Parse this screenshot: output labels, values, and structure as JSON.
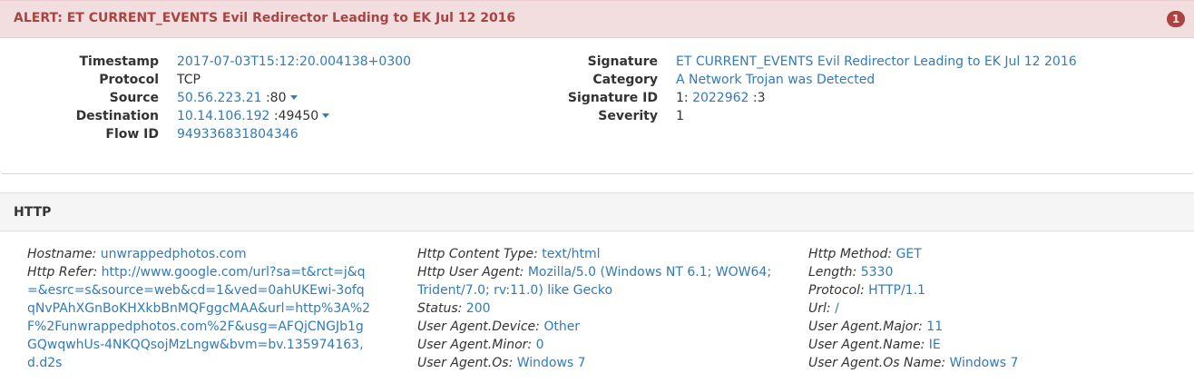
{
  "alert": {
    "title": "ALERT: ET CURRENT_EVENTS Evil Redirector Leading to EK Jul 12 2016",
    "badge": "1",
    "left": [
      {
        "label": "Timestamp",
        "value": "2017-07-03T15:12:20.004138+0300",
        "link": true
      },
      {
        "label": "Protocol",
        "value": "TCP",
        "link": false
      },
      {
        "label": "Source",
        "value": "50.56.223.21",
        "suffix": " :80",
        "link": true,
        "caret": true
      },
      {
        "label": "Destination",
        "value": "10.14.106.192",
        "suffix": " :49450",
        "link": true,
        "caret": true
      },
      {
        "label": "Flow ID",
        "value": "949336831804346",
        "link": true
      }
    ],
    "right": [
      {
        "label": "Signature",
        "value": "ET CURRENT_EVENTS Evil Redirector Leading to EK Jul 12 2016",
        "link": true
      },
      {
        "label": "Category",
        "value": "A Network Trojan was Detected",
        "link": true
      },
      {
        "label": "Signature ID",
        "prefix": "1: ",
        "value": "2022962",
        "suffix": " :3",
        "link": true
      },
      {
        "label": "Severity",
        "value": "1",
        "link": false
      }
    ]
  },
  "http": {
    "title": "HTTP",
    "col1": [
      {
        "key": "Hostname:",
        "value": "unwrappedphotos.com"
      },
      {
        "key": "Http Refer:",
        "value": "http://www.google.com/url?sa=t&rct=j&q=&esrc=s&source=web&cd=1&ved=0ahUKEwi-3ofqqNvPAhXGnBoKHXkbBnMQFggcMAA&url=http%3A%2F%2Funwrappedphotos.com%2F&usg=AFQjCNGJb1gGQwqwhUs-4NKQQsojMzLngw&bvm=bv.135974163,d.d2s"
      }
    ],
    "col2": [
      {
        "key": "Http Content Type:",
        "value": "text/html"
      },
      {
        "key": "Http User Agent:",
        "value": "Mozilla/5.0 (Windows NT 6.1; WOW64; Trident/7.0; rv:11.0) like Gecko"
      },
      {
        "key": "Status:",
        "value": "200"
      },
      {
        "key": "User Agent.Device:",
        "value": "Other"
      },
      {
        "key": "User Agent.Minor:",
        "value": "0"
      },
      {
        "key": "User Agent.Os:",
        "value": "Windows 7"
      }
    ],
    "col3": [
      {
        "key": "Http Method:",
        "value": "GET"
      },
      {
        "key": "Length:",
        "value": "5330"
      },
      {
        "key": "Protocol:",
        "value": "HTTP/1.1"
      },
      {
        "key": "Url:",
        "value": "/"
      },
      {
        "key": "User Agent.Major:",
        "value": "11"
      },
      {
        "key": "User Agent.Name:",
        "value": "IE"
      },
      {
        "key": "User Agent.Os Name:",
        "value": "Windows 7"
      }
    ]
  }
}
